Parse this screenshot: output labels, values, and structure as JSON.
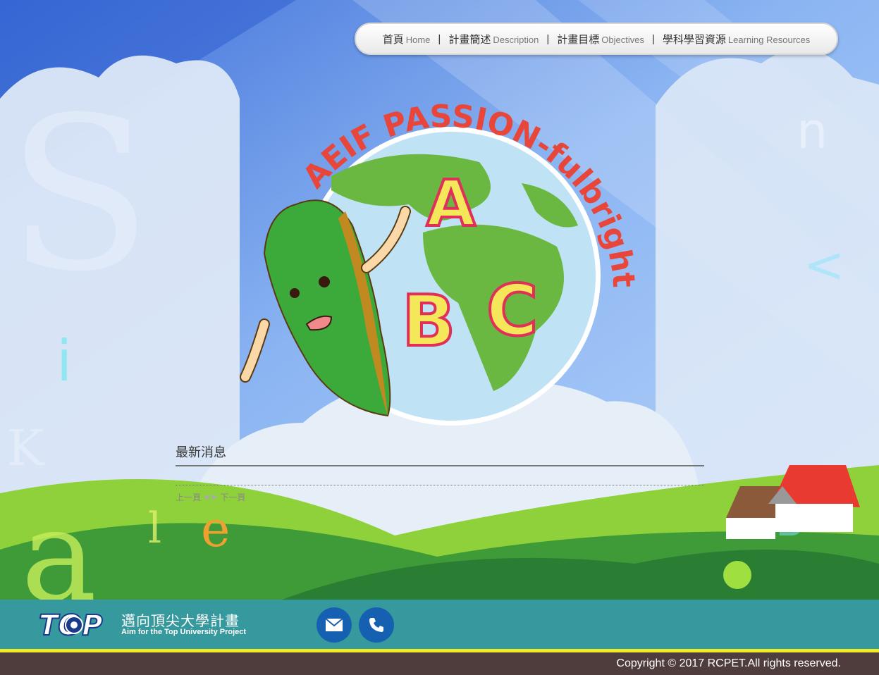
{
  "nav": {
    "items": [
      {
        "cn": "首頁",
        "en": "Home"
      },
      {
        "cn": "計畫簡述",
        "en": "Description"
      },
      {
        "cn": "計畫目標",
        "en": "Objectives"
      },
      {
        "cn": "學科學習資源",
        "en": "Learning Resources"
      }
    ],
    "separator": "|"
  },
  "logo": {
    "arc_text": "AEIF PASSION-fulbright",
    "letters": [
      "A",
      "B",
      "C"
    ]
  },
  "news": {
    "title": "最新消息",
    "prev": "上一頁",
    "next": "下一頁"
  },
  "footer": {
    "top_logo": "TOP",
    "cn": "邁向頂尖大學計畫",
    "en": "Aim for the Top University Project",
    "copyright": "Copyright © 2017 RCPET.All rights reserved."
  },
  "icons": {
    "mail": "mail-icon",
    "phone": "phone-icon"
  },
  "colors": {
    "footer_teal": "#35999d",
    "footer_brown": "#4f3c3d",
    "accent_yellow": "#f1ec2a",
    "button_blue": "#1560b0",
    "logo_red": "#e8463a"
  }
}
